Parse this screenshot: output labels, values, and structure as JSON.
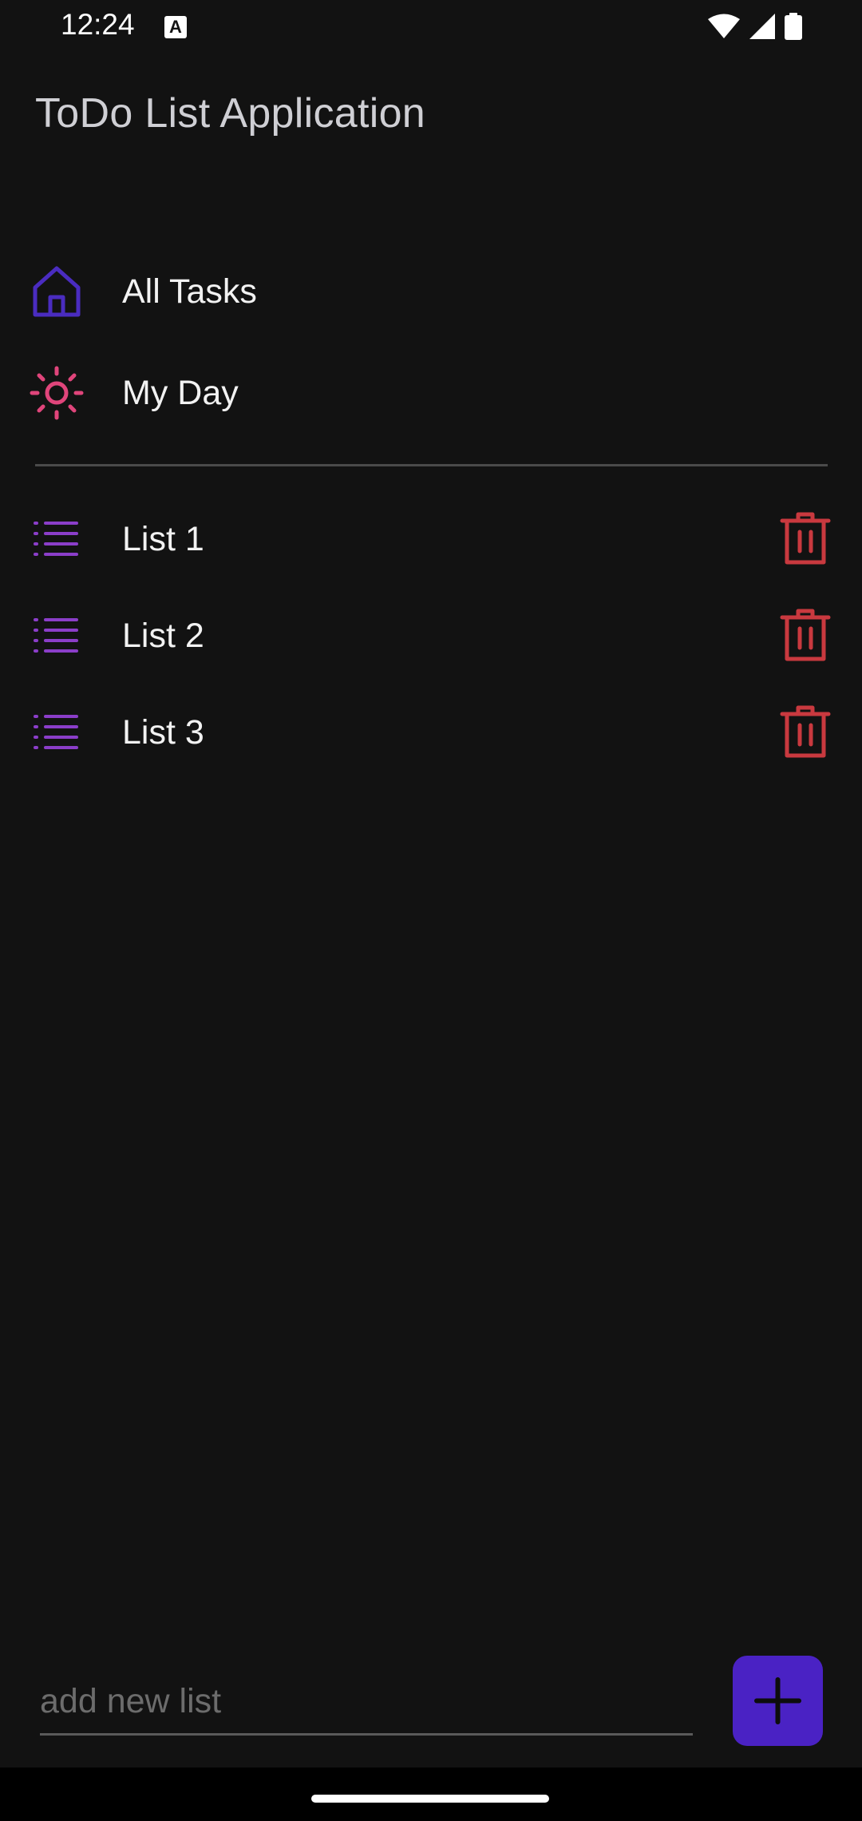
{
  "status_bar": {
    "time": "12:24",
    "icons": [
      "a-notification-icon",
      "wifi-icon",
      "signal-icon",
      "battery-icon"
    ]
  },
  "app": {
    "title": "ToDo List Application"
  },
  "nav": {
    "all_tasks": {
      "label": "All Tasks",
      "icon": "home-icon",
      "color": "#4a2cc0"
    },
    "my_day": {
      "label": "My Day",
      "icon": "sun-icon",
      "color": "#e0457b"
    }
  },
  "lists": {
    "icon": "list-icon",
    "icon_color": "#8b3ec9",
    "delete_icon": "trash-icon",
    "delete_color": "#c9393f",
    "items": [
      {
        "label": "List 1"
      },
      {
        "label": "List 2"
      },
      {
        "label": "List 3"
      }
    ]
  },
  "new_list": {
    "placeholder": "add new list",
    "value": ""
  },
  "add_button": {
    "icon": "plus-icon",
    "color": "#4a22c4"
  }
}
